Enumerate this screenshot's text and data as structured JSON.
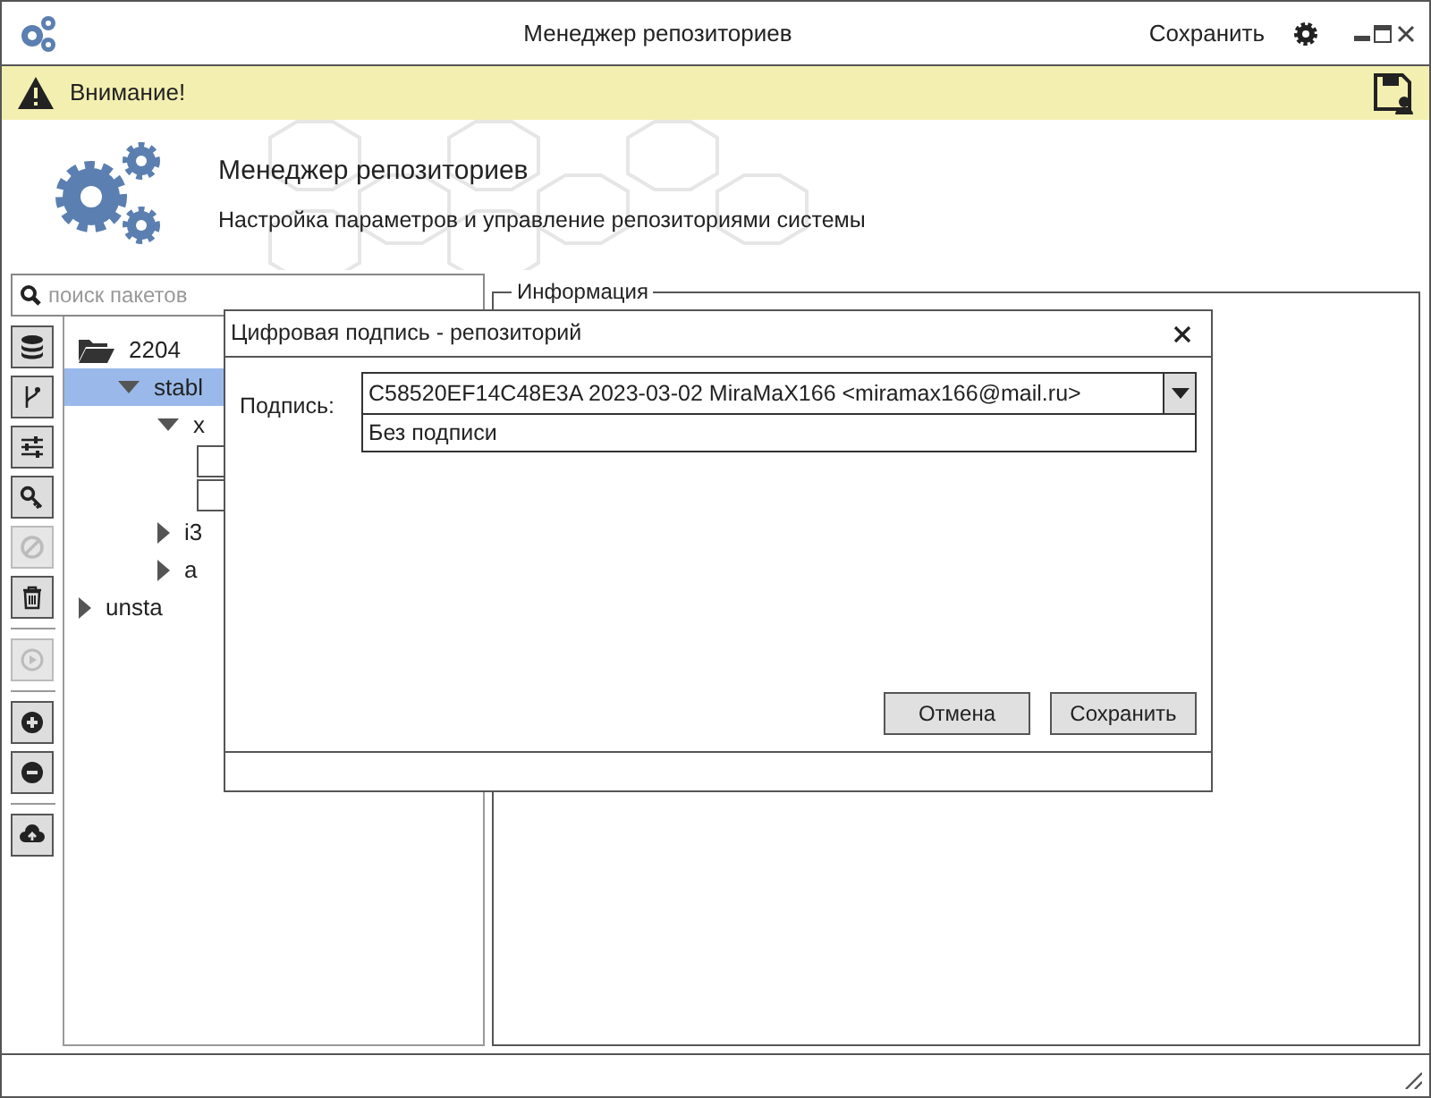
{
  "window": {
    "title": "Менеджер репозиториев",
    "save_label": "Сохранить"
  },
  "warning": {
    "text": "Внимание!"
  },
  "header": {
    "title": "Менеджер репозиториев",
    "subtitle": "Настройка параметров и управление репозиториями системы"
  },
  "search": {
    "placeholder": "поиск пакетов"
  },
  "toolbar": [
    {
      "kind": "database",
      "disabled": false
    },
    {
      "kind": "branch",
      "disabled": false
    },
    {
      "kind": "sliders",
      "disabled": false
    },
    {
      "kind": "key",
      "disabled": false
    },
    {
      "kind": "ban",
      "disabled": true
    },
    {
      "kind": "trash",
      "disabled": false
    },
    {
      "kind": "separator"
    },
    {
      "kind": "play",
      "disabled": true
    },
    {
      "kind": "separator"
    },
    {
      "kind": "plus",
      "disabled": false
    },
    {
      "kind": "minus",
      "disabled": false
    },
    {
      "kind": "separator"
    },
    {
      "kind": "upload",
      "disabled": false
    }
  ],
  "tree": [
    {
      "label": "2204",
      "kind": "folder",
      "expanded": true,
      "selected": false,
      "children": [
        {
          "label": "stabl",
          "kind": "node",
          "expanded": true,
          "selected": true,
          "children": [
            {
              "label": "x",
              "kind": "node",
              "expanded": true,
              "selected": false,
              "children": [
                {
                  "kind": "box",
                  "selected": false
                },
                {
                  "kind": "box",
                  "selected": false
                }
              ]
            },
            {
              "label": "i3",
              "kind": "node",
              "expanded": false,
              "selected": false
            },
            {
              "label": "a",
              "kind": "node",
              "expanded": false,
              "selected": false
            }
          ]
        }
      ]
    },
    {
      "label": "unsta",
      "kind": "node",
      "expanded": false,
      "selected": false
    }
  ],
  "info": {
    "title": "Информация"
  },
  "dialog": {
    "title": "Цифровая подпись - репозиторий",
    "label": "Подпись:",
    "value": "C58520EF14C48E3A 2023-03-02 MiraMaX166 <miramax166@mail.ru>",
    "options": [
      "Без подписи"
    ],
    "buttons": [
      "Отмена",
      "Сохранить"
    ]
  }
}
